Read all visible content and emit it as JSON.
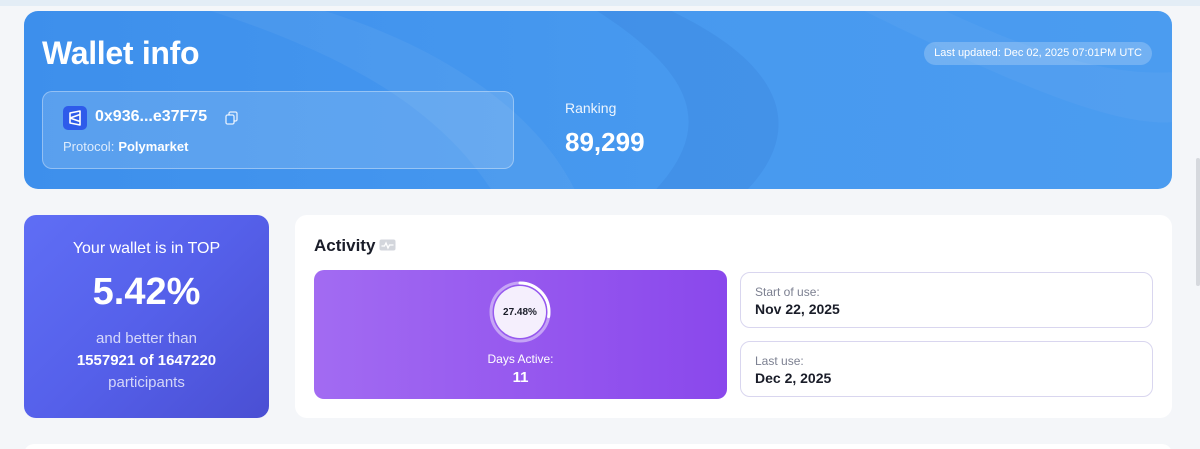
{
  "wallet": {
    "title": "Wallet info",
    "last_updated": "Last updated: Dec 02, 2025 07:01PM UTC",
    "address": "0x936...e37F75",
    "protocol_label": "Protocol:",
    "protocol_value": "Polymarket",
    "ranking_label": "Ranking",
    "ranking_value": "89,299"
  },
  "top": {
    "heading": "Your wallet is in TOP",
    "percent": "5.42%",
    "better_than": "and better than",
    "count": "1557921 of 1647220",
    "participants": "participants"
  },
  "activity": {
    "title": "Activity",
    "ring_percent_label": "27.48%",
    "ring_fraction": 0.2748,
    "days_active_label": "Days Active:",
    "days_active_value": "11",
    "start_label": "Start of use:",
    "start_value": "Nov 22, 2025",
    "last_label": "Last use:",
    "last_value": "Dec 2, 2025"
  },
  "colors": {
    "header_blue": "#4799ef",
    "top_card_indigo": "#5560ea",
    "days_panel_purple": "#9455ee",
    "polymarket_blue": "#2e5bea"
  },
  "icons": {
    "protocol": "polymarket-logo-icon",
    "copy": "copy-icon",
    "activity": "activity-chart-icon"
  }
}
